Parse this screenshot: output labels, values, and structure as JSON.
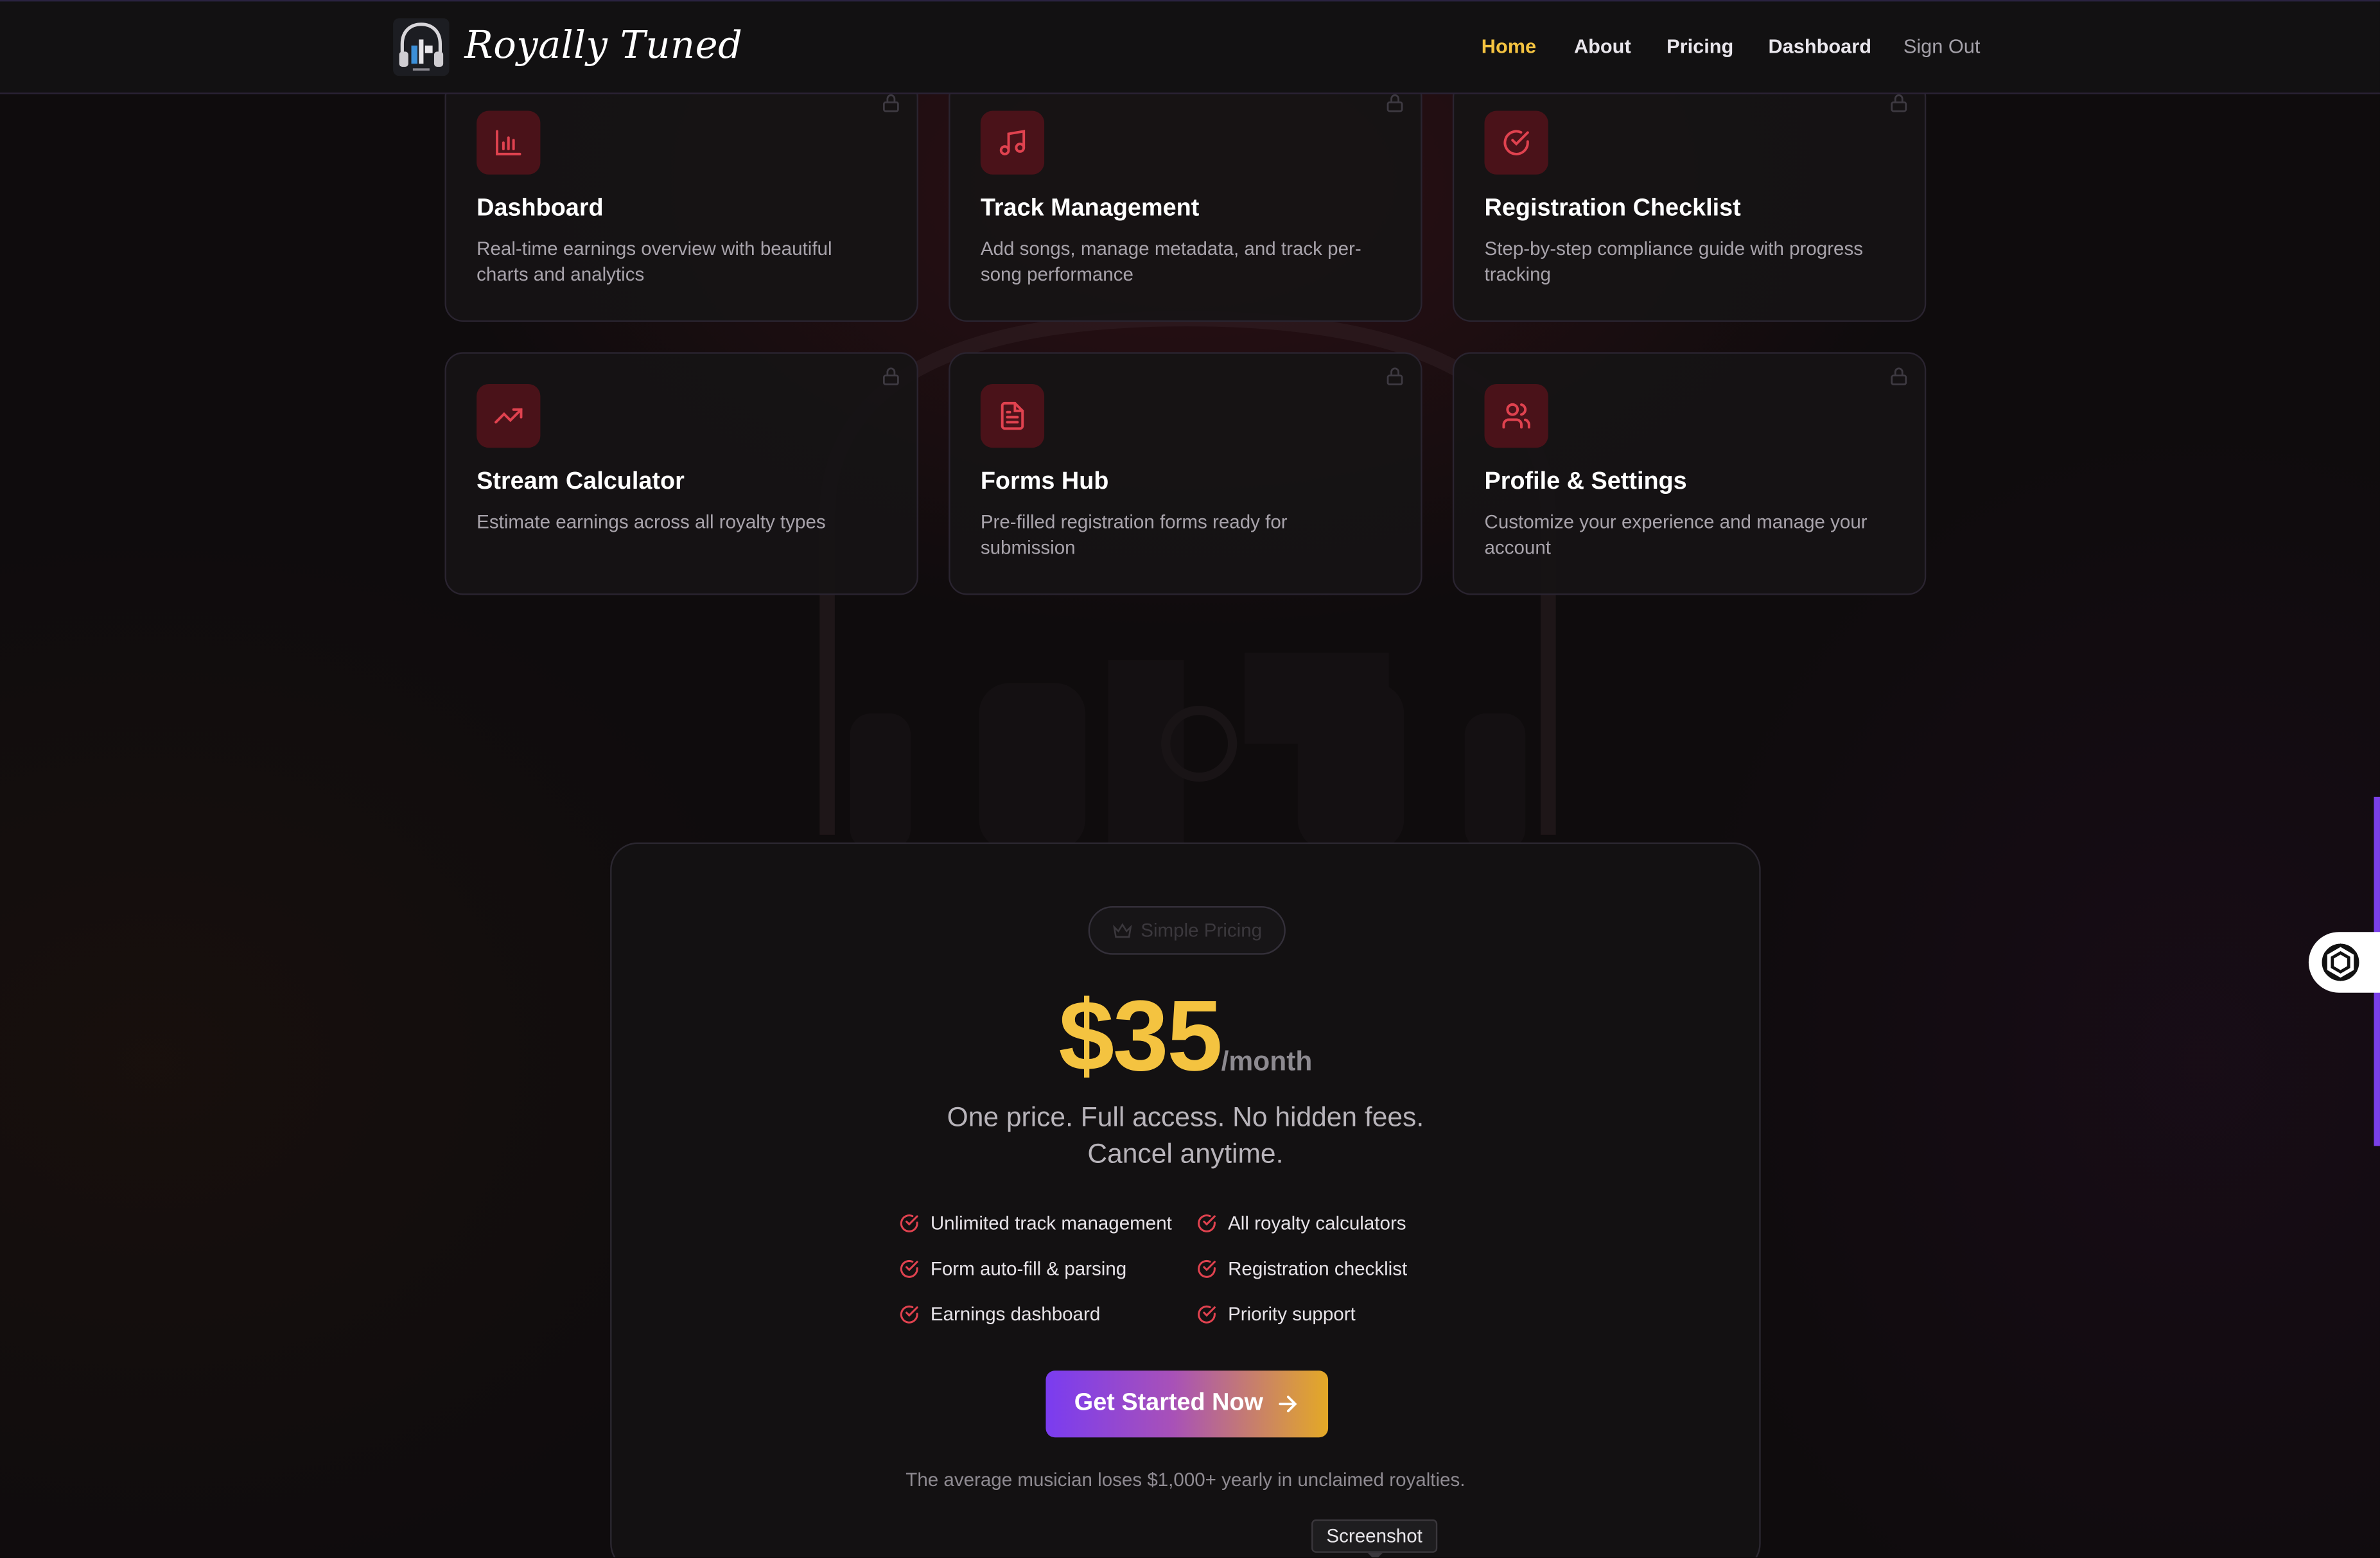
{
  "nav": {
    "brand": "Royally Tuned",
    "links": [
      {
        "label": "Home",
        "state": "active"
      },
      {
        "label": "About"
      },
      {
        "label": "Pricing"
      },
      {
        "label": "Dashboard"
      },
      {
        "label": "Sign Out",
        "state": "muted"
      }
    ]
  },
  "features": [
    {
      "icon": "bar-chart-icon",
      "title": "Dashboard",
      "desc": "Real-time earnings overview with beautiful charts and analytics"
    },
    {
      "icon": "music-note-icon",
      "title": "Track Management",
      "desc": "Add songs, manage metadata, and track per-song performance"
    },
    {
      "icon": "check-circle-icon",
      "title": "Registration Checklist",
      "desc": "Step-by-step compliance guide with progress tracking"
    },
    {
      "icon": "trending-up-icon",
      "title": "Stream Calculator",
      "desc": "Estimate earnings across all royalty types"
    },
    {
      "icon": "document-icon",
      "title": "Forms Hub",
      "desc": "Pre-filled registration forms ready for submission"
    },
    {
      "icon": "users-icon",
      "title": "Profile & Settings",
      "desc": "Customize your experience and manage your account"
    }
  ],
  "pricing": {
    "badge": "Simple Pricing",
    "amount": "$35",
    "period": "/month",
    "tagline_1": "One price. Full access. No hidden fees.",
    "tagline_2": "Cancel anytime.",
    "features": [
      "Unlimited track management",
      "All royalty calculators",
      "Form auto-fill & parsing",
      "Registration checklist",
      "Earnings dashboard",
      "Priority support"
    ],
    "cta": "Get Started Now",
    "note": "The average musician loses $1,000+ yearly in unclaimed royalties."
  },
  "tooltip": "Screenshot",
  "colors": {
    "accent_gold": "#f4c340",
    "icon_red": "#e0424f",
    "icon_bg": "#4a1219",
    "cta_gradient_start": "#7a3cf0",
    "cta_gradient_end": "#e4a926"
  }
}
